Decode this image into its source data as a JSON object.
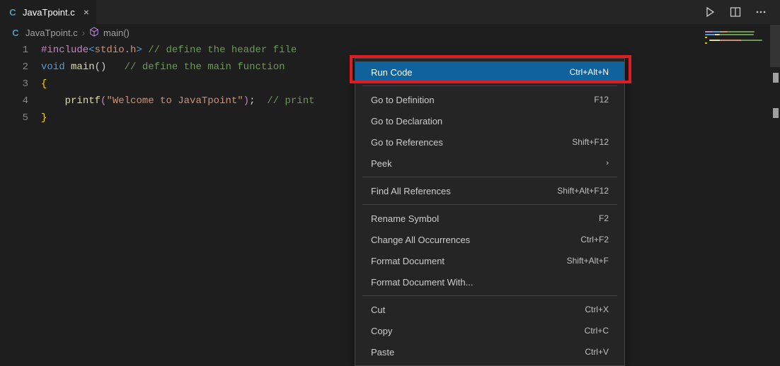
{
  "tab": {
    "filename": "JavaTpoint.c"
  },
  "breadcrumb": {
    "file": "JavaTpoint.c",
    "symbol": "main()"
  },
  "code": {
    "lines": [
      {
        "num": "1",
        "tokens": [
          {
            "t": "#include",
            "c": "tk-keyword"
          },
          {
            "t": "<",
            "c": "tk-angle"
          },
          {
            "t": "stdio.h",
            "c": "tk-header"
          },
          {
            "t": ">",
            "c": "tk-angle"
          },
          {
            "t": " ",
            "c": ""
          },
          {
            "t": "// define the header file",
            "c": "tk-comment"
          }
        ]
      },
      {
        "num": "2",
        "tokens": [
          {
            "t": "void",
            "c": "tk-type"
          },
          {
            "t": " ",
            "c": ""
          },
          {
            "t": "main",
            "c": "tk-func"
          },
          {
            "t": "()",
            "c": "tk-punct"
          },
          {
            "t": "   ",
            "c": ""
          },
          {
            "t": "// define the main function",
            "c": "tk-comment"
          }
        ]
      },
      {
        "num": "3",
        "tokens": [
          {
            "t": "{",
            "c": "tk-brace"
          }
        ]
      },
      {
        "num": "4",
        "tokens": [
          {
            "t": "    ",
            "c": ""
          },
          {
            "t": "printf",
            "c": "tk-func"
          },
          {
            "t": "(",
            "c": "tk-paren"
          },
          {
            "t": "\"Welcome to JavaTpoint\"",
            "c": "tk-string"
          },
          {
            "t": ")",
            "c": "tk-paren"
          },
          {
            "t": ";",
            "c": "tk-punct"
          },
          {
            "t": "  ",
            "c": ""
          },
          {
            "t": "// print",
            "c": "tk-comment"
          }
        ]
      },
      {
        "num": "5",
        "tokens": [
          {
            "t": "}",
            "c": "tk-brace"
          }
        ]
      }
    ]
  },
  "context_menu": {
    "groups": [
      [
        {
          "label": "Run Code",
          "shortcut": "Ctrl+Alt+N",
          "highlighted": true
        }
      ],
      [
        {
          "label": "Go to Definition",
          "shortcut": "F12"
        },
        {
          "label": "Go to Declaration",
          "shortcut": ""
        },
        {
          "label": "Go to References",
          "shortcut": "Shift+F12"
        },
        {
          "label": "Peek",
          "shortcut": "",
          "submenu": true
        }
      ],
      [
        {
          "label": "Find All References",
          "shortcut": "Shift+Alt+F12"
        }
      ],
      [
        {
          "label": "Rename Symbol",
          "shortcut": "F2"
        },
        {
          "label": "Change All Occurrences",
          "shortcut": "Ctrl+F2"
        },
        {
          "label": "Format Document",
          "shortcut": "Shift+Alt+F"
        },
        {
          "label": "Format Document With...",
          "shortcut": ""
        }
      ],
      [
        {
          "label": "Cut",
          "shortcut": "Ctrl+X"
        },
        {
          "label": "Copy",
          "shortcut": "Ctrl+C"
        },
        {
          "label": "Paste",
          "shortcut": "Ctrl+V"
        }
      ]
    ]
  }
}
